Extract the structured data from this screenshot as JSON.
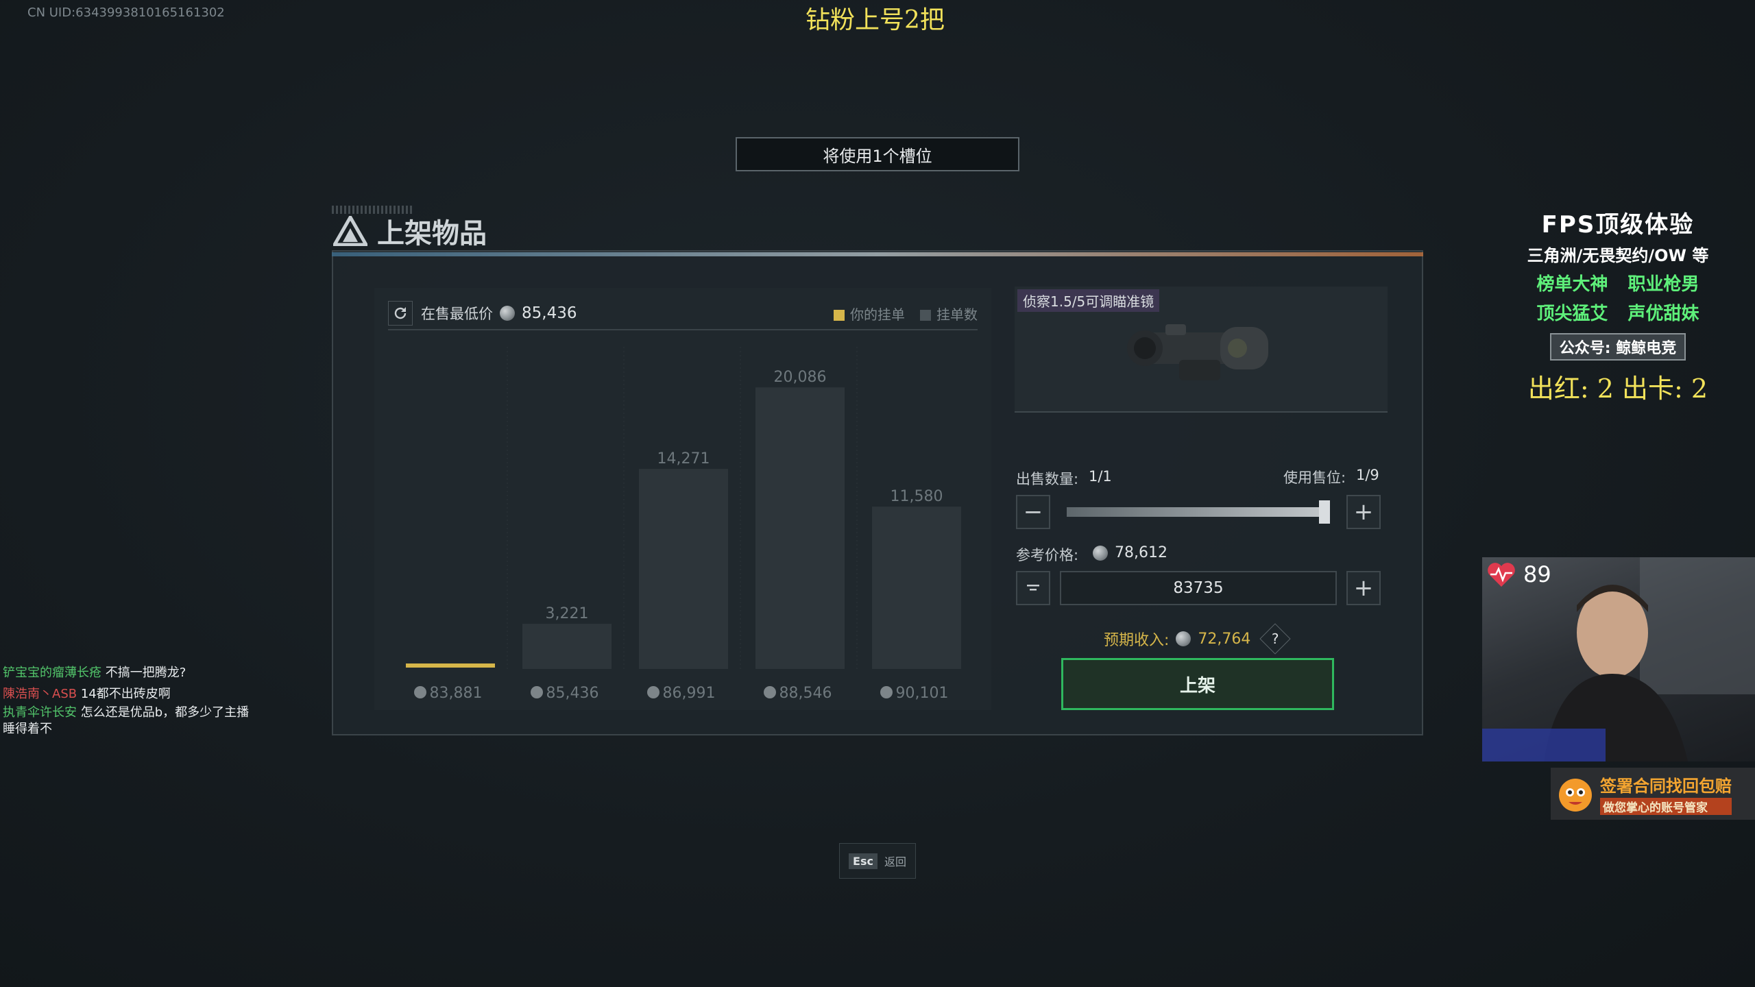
{
  "uid": "CN UID:6343993810165161302",
  "stream_title": "钻粉上号2把",
  "slot_notice": "将使用1个槽位",
  "panel": {
    "title": "上架物品"
  },
  "chart_header": {
    "label": "在售最低价",
    "price": "85,436",
    "legend": [
      {
        "label": "你的挂单",
        "color": "#d6b64a"
      },
      {
        "label": "挂单数",
        "color": "#4a5358"
      }
    ]
  },
  "chart_data": {
    "type": "bar",
    "categories": [
      "83,881",
      "85,436",
      "86,991",
      "88,546",
      "90,101"
    ],
    "values": [
      0,
      3221,
      14271,
      20086,
      11580
    ],
    "value_labels": [
      "",
      "3,221",
      "14,271",
      "20,086",
      "11,580"
    ],
    "highlight_index": 0,
    "highlight_color": "#d6b64a",
    "bar_color": "#2d353a",
    "ylim": [
      0,
      22000
    ]
  },
  "item": {
    "name": "侦察1.5/5可调瞄准镜"
  },
  "sell": {
    "qty_label": "出售数量:",
    "qty_value": "1/1",
    "slots_label": "使用售位:",
    "slots_value": "1/9",
    "slider_fraction": 1.0,
    "ref_label": "参考价格:",
    "ref_value": "78,612",
    "price_input": "83735",
    "income_label": "预期收入:",
    "income_value": "72,764",
    "help": "?",
    "list_button": "上架"
  },
  "esc": {
    "key": "Esc",
    "label": "返回"
  },
  "chat": [
    {
      "name": "铲宝宝的瘤薄长疮",
      "msg": "不搞一把腾龙?"
    },
    {
      "name": "陳浩南丶ASB",
      "msg": "14都不出砖皮啊"
    },
    {
      "name": "执青伞许长安",
      "msg": "怎么还是优品b，都多少了主播睡得着不"
    }
  ],
  "promo": {
    "line1": "FPS顶级体验",
    "line2": "三角洲/无畏契约/OW 等",
    "line3": "榜单大神 职业枪男",
    "line4": "顶尖猛艾 声优甜妹",
    "line5": "公众号: 鲸鲸电竞",
    "line6": "出红: 2 出卡: 2"
  },
  "heart_rate": "89",
  "banner": {
    "line1": "签署合同找回包赔",
    "line2": "做您掌心的账号管家"
  }
}
